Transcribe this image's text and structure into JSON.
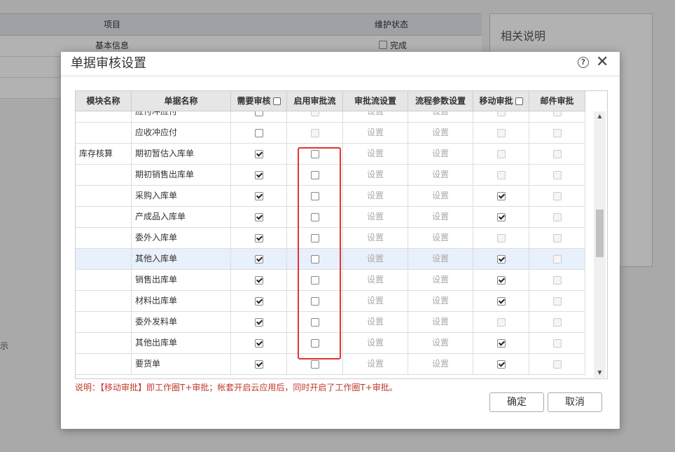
{
  "background": {
    "table_headers": [
      "项目",
      "维护状态"
    ],
    "first_row": {
      "item": "基本信息",
      "status": "完成"
    },
    "panel_title": "相关说明",
    "side_hint": "示"
  },
  "dialog": {
    "title": "单据审核设置",
    "help_icon": "question-circle-icon",
    "close_icon": "close-icon",
    "columns": [
      "模块名称",
      "单据名称",
      "需要审核",
      "启用审批流",
      "审批流设置",
      "流程参数设置",
      "移动审批",
      "邮件审批"
    ],
    "rows": [
      {
        "module": "",
        "doc": "应付冲应付",
        "need": false,
        "flow": false,
        "flow_setting": "设置",
        "param_setting": "设置",
        "mobile": false,
        "mail": false,
        "flow_enabled": false
      },
      {
        "module": "",
        "doc": "应收冲应付",
        "need": false,
        "flow": false,
        "flow_setting": "设置",
        "param_setting": "设置",
        "mobile": false,
        "mail": false,
        "flow_enabled": false
      },
      {
        "module": "库存核算",
        "doc": "期初暂估入库单",
        "need": true,
        "flow": false,
        "flow_setting": "设置",
        "param_setting": "设置",
        "mobile": false,
        "mail": false,
        "flow_enabled": true
      },
      {
        "module": "",
        "doc": "期初销售出库单",
        "need": true,
        "flow": false,
        "flow_setting": "设置",
        "param_setting": "设置",
        "mobile": false,
        "mail": false,
        "flow_enabled": true
      },
      {
        "module": "",
        "doc": "采购入库单",
        "need": true,
        "flow": false,
        "flow_setting": "设置",
        "param_setting": "设置",
        "mobile": true,
        "mail": false,
        "flow_enabled": true
      },
      {
        "module": "",
        "doc": "产成品入库单",
        "need": true,
        "flow": false,
        "flow_setting": "设置",
        "param_setting": "设置",
        "mobile": true,
        "mail": false,
        "flow_enabled": true
      },
      {
        "module": "",
        "doc": "委外入库单",
        "need": true,
        "flow": false,
        "flow_setting": "设置",
        "param_setting": "设置",
        "mobile": false,
        "mail": false,
        "flow_enabled": true
      },
      {
        "module": "",
        "doc": "其他入库单",
        "need": true,
        "flow": false,
        "flow_setting": "设置",
        "param_setting": "设置",
        "mobile": true,
        "mail": false,
        "flow_enabled": true,
        "selected": true
      },
      {
        "module": "",
        "doc": "销售出库单",
        "need": true,
        "flow": false,
        "flow_setting": "设置",
        "param_setting": "设置",
        "mobile": true,
        "mail": false,
        "flow_enabled": true
      },
      {
        "module": "",
        "doc": "材料出库单",
        "need": true,
        "flow": false,
        "flow_setting": "设置",
        "param_setting": "设置",
        "mobile": true,
        "mail": false,
        "flow_enabled": true
      },
      {
        "module": "",
        "doc": "委外发料单",
        "need": true,
        "flow": false,
        "flow_setting": "设置",
        "param_setting": "设置",
        "mobile": false,
        "mail": false,
        "flow_enabled": true
      },
      {
        "module": "",
        "doc": "其他出库单",
        "need": true,
        "flow": false,
        "flow_setting": "设置",
        "param_setting": "设置",
        "mobile": true,
        "mail": false,
        "flow_enabled": true
      },
      {
        "module": "",
        "doc": "要货单",
        "need": true,
        "flow": false,
        "flow_setting": "设置",
        "param_setting": "设置",
        "mobile": true,
        "mail": false,
        "flow_enabled": true
      }
    ],
    "note": "说明：【移动审批】即工作圈T+审批；帐套开启云应用后，同时开启了工作圈T+审批。",
    "ok_label": "确定",
    "cancel_label": "取消",
    "highlight_color": "#e53333"
  }
}
